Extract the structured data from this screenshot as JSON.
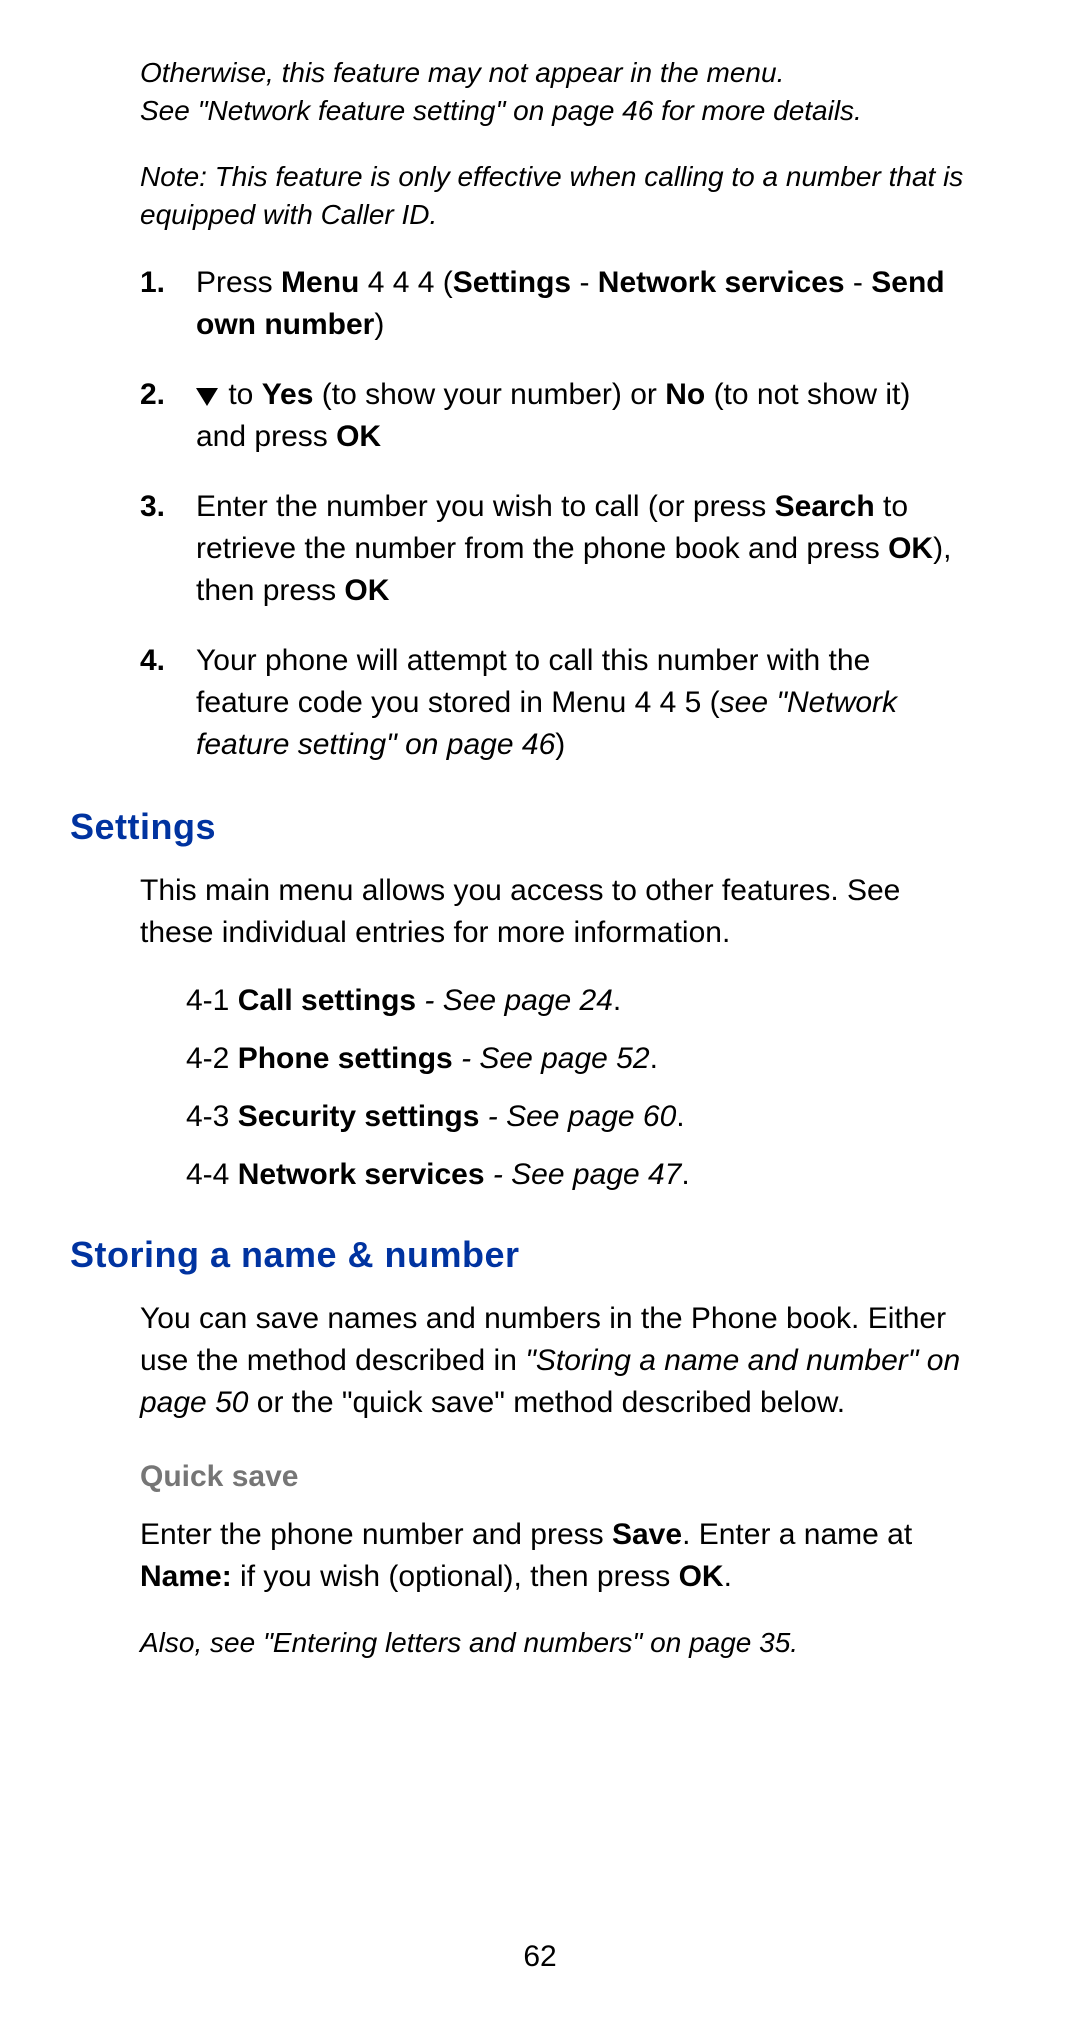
{
  "intro": {
    "otherwise_line1": "Otherwise, this feature may not appear in the menu.",
    "otherwise_line2": "See \"Network feature setting\" on page 46 for more details.",
    "note": "Note: This feature is only effective when calling to a number that is equipped with Caller ID."
  },
  "steps": {
    "n1": "1.",
    "s1_pre": "Press ",
    "s1_menu": "Menu",
    "s1_mid": " 4 4 4 (",
    "s1_settings": "Settings",
    "s1_dash1": " - ",
    "s1_net": "Network services",
    "s1_dash2": " - ",
    "s1_send": "Send own number",
    "s1_post": ")",
    "n2": "2.",
    "s2_pre": " to ",
    "s2_yes": "Yes",
    "s2_mid": " (to show your number) or ",
    "s2_no": "No",
    "s2_mid2": " (to not show it) and press ",
    "s2_ok": "OK",
    "n3": "3.",
    "s3_pre": "Enter the number you wish to call (or press ",
    "s3_search": "Search",
    "s3_mid": " to retrieve the number from the phone book and press ",
    "s3_ok1": "OK",
    "s3_mid2": "), then press ",
    "s3_ok2": "OK",
    "n4": "4.",
    "s4_pre": "Your phone will attempt to call this number with the feature code you stored in Menu 4 4 5 (",
    "s4_ref": "see \"Network feature setting\" on page 46",
    "s4_post": ")"
  },
  "settings": {
    "heading": "Settings",
    "intro": "This main menu allows you access to other features. See these individual entries for more information.",
    "i1_num": "4-1 ",
    "i1_bold": "Call settings",
    "i1_ref": " - See page 24",
    "i2_num": "4-2 ",
    "i2_bold": "Phone settings",
    "i2_ref": " - See page 52",
    "i3_num": "4-3 ",
    "i3_bold": "Security settings",
    "i3_ref": " - See page 60",
    "i4_num": "4-4 ",
    "i4_bold": "Network services",
    "i4_ref": " - See page 47",
    "dot": "."
  },
  "storing": {
    "heading": "Storing a name & number",
    "p_pre": "You can save names and numbers in the Phone book. Either use the method described in ",
    "p_ref": "\"Storing a name and number\" on page 50",
    "p_post": " or the \"quick save\" method described below.",
    "quick_heading": "Quick save",
    "q_pre": "Enter the phone number and press ",
    "q_save": "Save",
    "q_mid": ". Enter a name at ",
    "q_name": "Name:",
    "q_mid2": " if you wish (optional), then press ",
    "q_ok": "OK",
    "q_post": ".",
    "also": "Also, see \"Entering letters and numbers\" on page 35."
  },
  "page_number": "62"
}
